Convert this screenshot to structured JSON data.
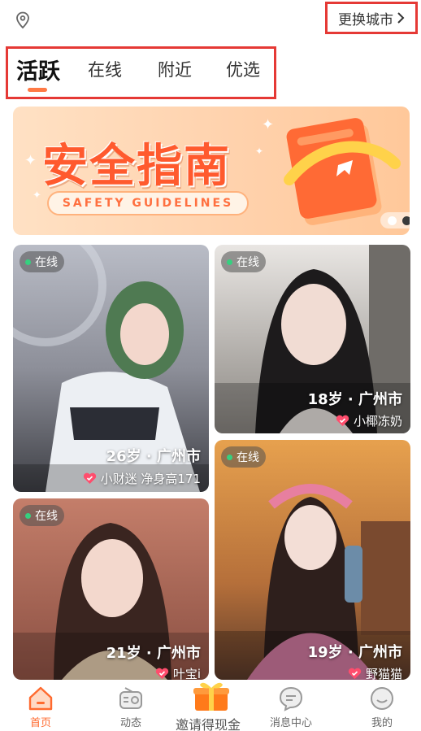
{
  "header": {
    "location_icon": "location-pin-icon",
    "city_button_label": "更换城市",
    "city_button_icon": "chevron-right-icon"
  },
  "tabs": [
    {
      "label": "活跃",
      "active": true
    },
    {
      "label": "在线",
      "active": false
    },
    {
      "label": "附近",
      "active": false
    },
    {
      "label": "优选",
      "active": false
    }
  ],
  "banner": {
    "title": "安全指南",
    "subtitle": "SAFETY GUIDELINES",
    "carousel_active_index": 1,
    "carousel_count": 2
  },
  "cards": [
    {
      "status": "在线",
      "age_city": "26岁 · 广州市",
      "name": "小财迷 净身高171"
    },
    {
      "status": "在线",
      "age_city": "18岁 · 广州市",
      "name": "小椰冻奶"
    },
    {
      "status": "在线",
      "age_city": "21岁 · 广州市",
      "name": "叶宝i"
    },
    {
      "status": "在线",
      "age_city": "19岁 · 广州市",
      "name": "野猫猫"
    }
  ],
  "nav": {
    "items": [
      {
        "label": "首页",
        "icon": "home-icon",
        "active": true
      },
      {
        "label": "动态",
        "icon": "radio-icon",
        "active": false
      },
      {
        "label": "邀请得现金",
        "icon": "gift-box-icon",
        "active": false
      },
      {
        "label": "消息中心",
        "icon": "chat-bubble-icon",
        "active": false
      },
      {
        "label": "我的",
        "icon": "smile-face-icon",
        "active": false
      }
    ]
  },
  "colors": {
    "accent": "#ff6a2f",
    "highlight_border": "#e53935",
    "online_dot": "#35d07f"
  }
}
